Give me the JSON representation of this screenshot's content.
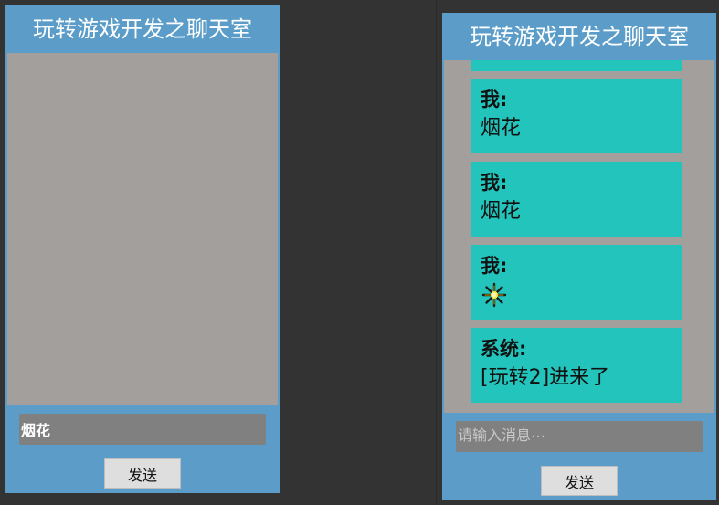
{
  "left_panel": {
    "title": "玩转游戏开发之聊天室",
    "input_value": "烟花",
    "send_label": "发送"
  },
  "right_panel": {
    "title": "玩转游戏开发之聊天室",
    "messages": [
      {
        "sender": "我:",
        "body": "烟花"
      },
      {
        "sender": "我:",
        "body": "烟花"
      },
      {
        "sender": "我:",
        "body": "",
        "icon": "fireworks-icon"
      },
      {
        "sender": "系统:",
        "body": "[玩转2]进来了"
      }
    ],
    "input_placeholder": "请输入消息···",
    "send_label": "发送"
  },
  "colors": {
    "panel": "#5b9dc8",
    "chat_bg": "#a39f9c",
    "bubble": "#22c4bc",
    "input": "#808080",
    "button": "#dedede"
  }
}
